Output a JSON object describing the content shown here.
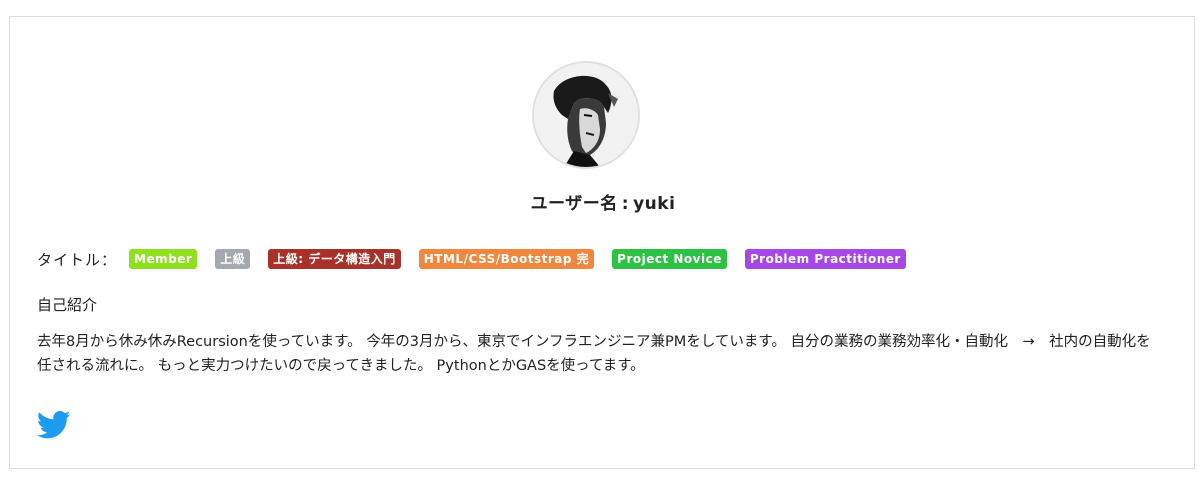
{
  "profile": {
    "username_label": "ユーザー名",
    "separator": ":",
    "username": "yuki"
  },
  "titles": {
    "label": "タイトル：",
    "badges": [
      {
        "text": "Member",
        "color": "#8fe01e"
      },
      {
        "text": "上級",
        "color": "#a3a9ae"
      },
      {
        "text": "上級: データ構造入門",
        "color": "#a83229"
      },
      {
        "text": "HTML/CSS/Bootstrap 完",
        "color": "#f0873f"
      },
      {
        "text": "Project Novice",
        "color": "#2ec245"
      },
      {
        "text": "Problem Practitioner",
        "color": "#a747e6"
      }
    ]
  },
  "intro": {
    "heading": "自己紹介",
    "body": "去年8月から休み休みRecursionを使っています。 今年の3月から、東京でインフラエンジニア兼PMをしています。 自分の業務の業務効率化・自動化　→　社内の自動化を任される流れに。 もっと実力つけたいので戻ってきました。 PythonとかGASを使ってます。"
  },
  "social": {
    "twitter_icon": "twitter-icon",
    "twitter_color": "#1d9bf0"
  }
}
